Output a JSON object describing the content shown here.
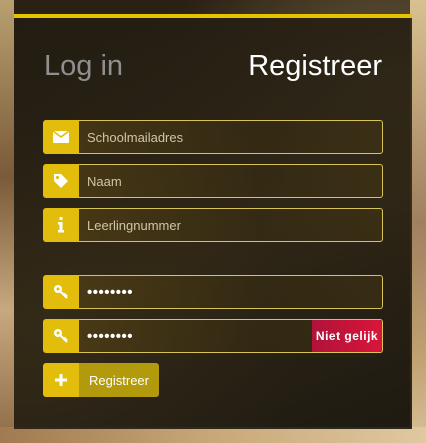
{
  "tabs": {
    "login_label": "Log in",
    "register_label": "Registreer"
  },
  "form": {
    "email": {
      "placeholder": "Schoolmailadres",
      "icon": "envelope-icon"
    },
    "name": {
      "placeholder": "Naam",
      "icon": "tag-icon"
    },
    "student_number": {
      "placeholder": "Leerlingnummer",
      "icon": "info-icon"
    },
    "password": {
      "value": "••••••••",
      "icon": "key-icon"
    },
    "password_confirm": {
      "value": "••••••••",
      "icon": "key-icon",
      "status": "Niet gelijk"
    },
    "submit": {
      "label": "Registreer",
      "icon": "plus-icon"
    }
  },
  "colors": {
    "accent": "#e2bd0c",
    "error": "#d8153a"
  }
}
